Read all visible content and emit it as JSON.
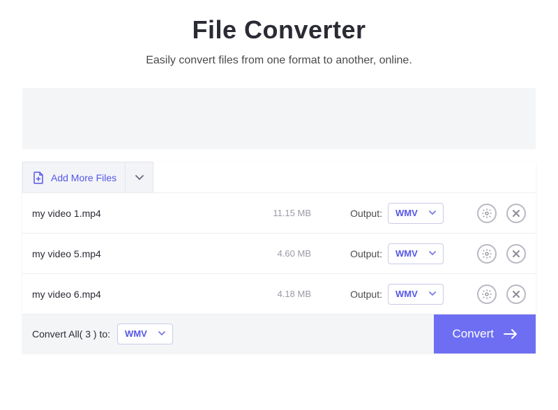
{
  "header": {
    "title": "File Converter",
    "subtitle": "Easily convert files from one format to another, online."
  },
  "add_more_label": "Add More Files",
  "output_label": "Output:",
  "files": [
    {
      "name": "my video 1.mp4",
      "size": "11.15 MB",
      "output_format": "WMV"
    },
    {
      "name": "my video 5.mp4",
      "size": "4.60 MB",
      "output_format": "WMV"
    },
    {
      "name": "my video 6.mp4",
      "size": "4.18 MB",
      "output_format": "WMV"
    }
  ],
  "footer": {
    "convert_all_label": "Convert All( 3 ) to:",
    "global_format": "WMV",
    "convert_button": "Convert"
  },
  "colors": {
    "accent": "#6e6ef2"
  }
}
